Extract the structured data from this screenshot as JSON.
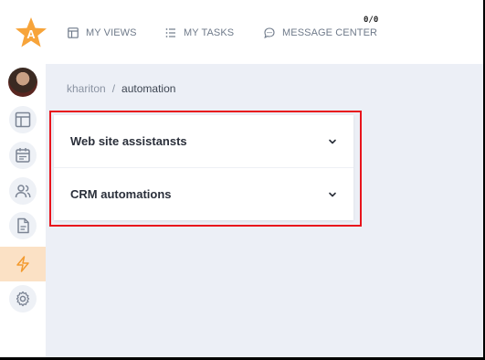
{
  "topbar": {
    "nav": [
      {
        "label": "MY VIEWS",
        "icon": "layout-icon"
      },
      {
        "label": "MY TASKS",
        "icon": "list-icon"
      },
      {
        "label": "MESSAGE CENTER",
        "icon": "chat-icon"
      }
    ],
    "message_counter": "0/0"
  },
  "sidebar": {
    "items": [
      {
        "name": "dashboard",
        "icon": "layout-icon"
      },
      {
        "name": "calendar",
        "icon": "calendar-icon"
      },
      {
        "name": "contacts",
        "icon": "users-icon"
      },
      {
        "name": "documents",
        "icon": "document-icon"
      },
      {
        "name": "automation",
        "icon": "lightning-icon",
        "active": true
      },
      {
        "name": "settings",
        "icon": "gear-icon"
      }
    ]
  },
  "breadcrumb": {
    "root": "khariton",
    "separator": "/",
    "current": "automation"
  },
  "accordion": {
    "items": [
      {
        "label": "Web site assistansts"
      },
      {
        "label": "CRM automations"
      }
    ]
  },
  "colors": {
    "accent": "#f7a43a",
    "active_bg": "#fbe1c5",
    "highlight": "#e8141c",
    "page_bg": "#eceff6"
  }
}
